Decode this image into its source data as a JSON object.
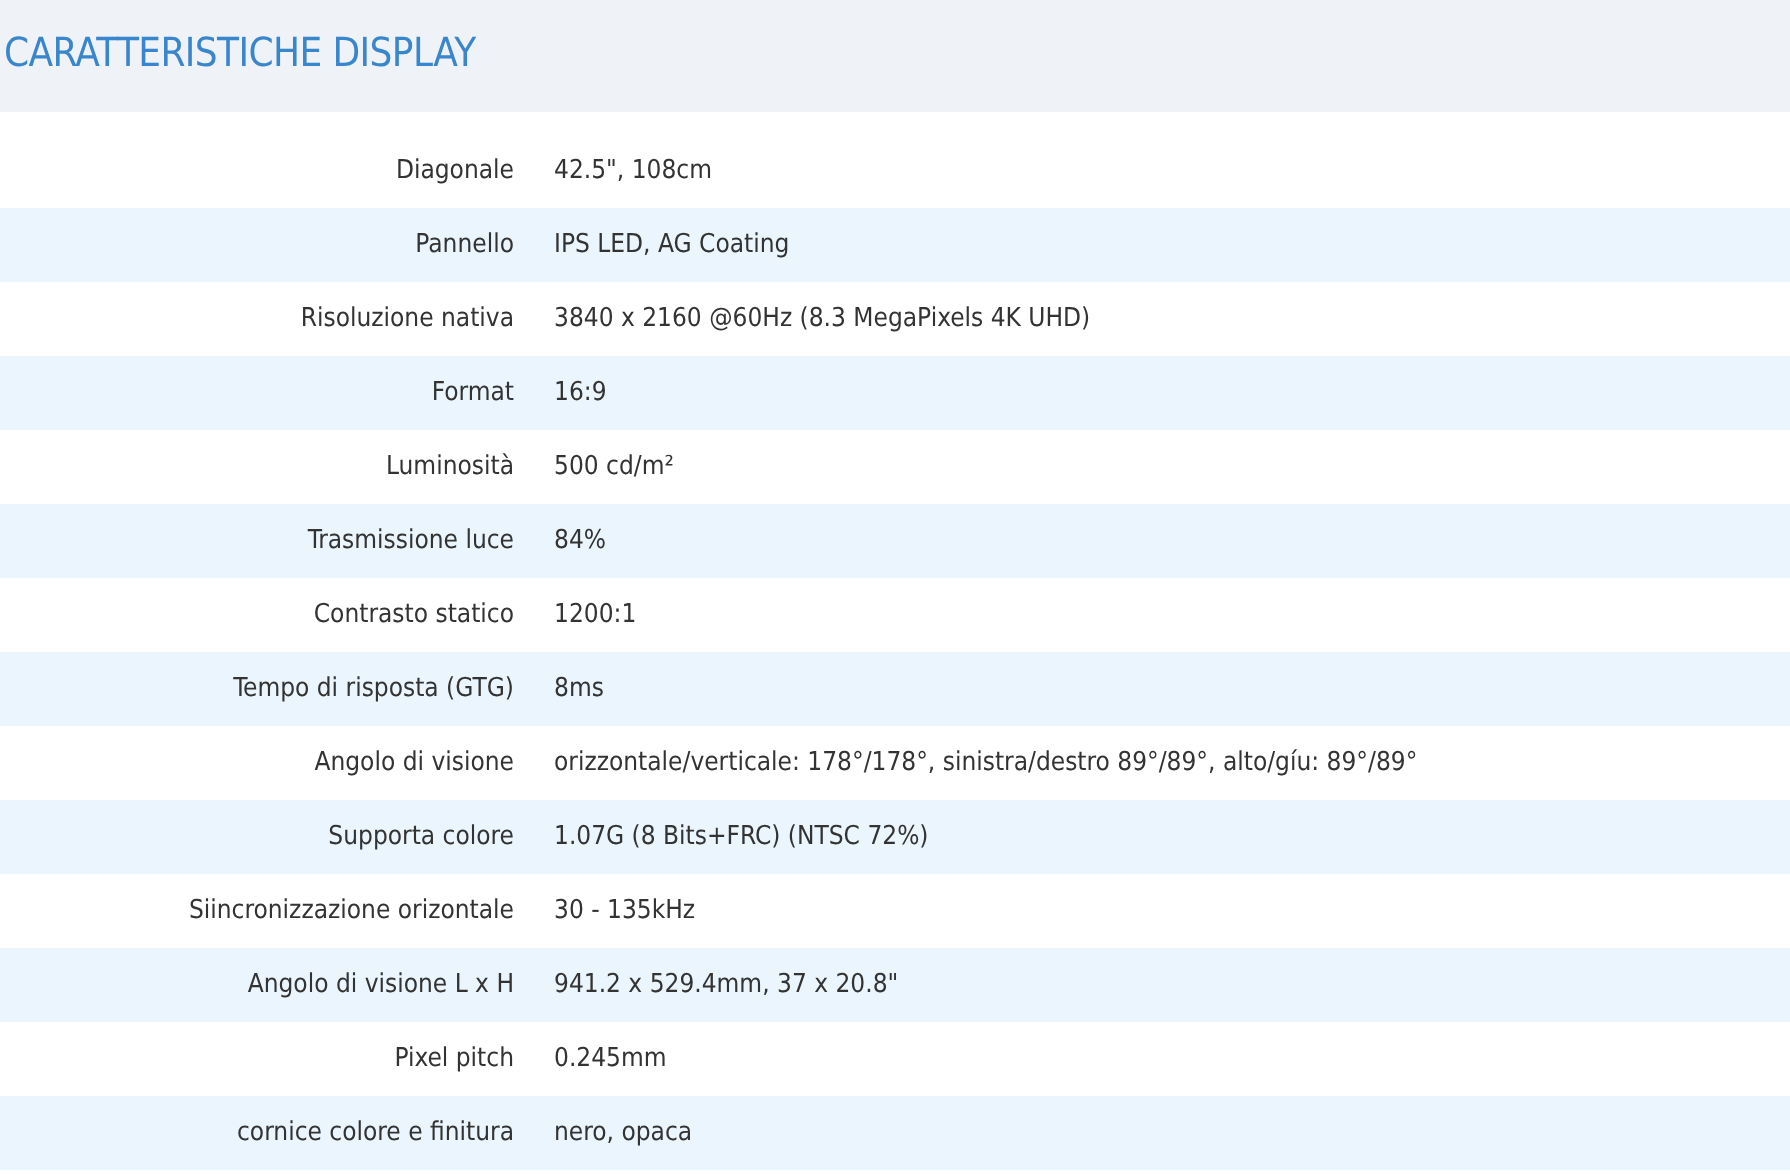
{
  "section": {
    "title": "CARATTERISTICHE DISPLAY"
  },
  "specs": [
    {
      "label": "Diagonale",
      "value": "42.5\", 108cm"
    },
    {
      "label": "Pannello",
      "value": "IPS LED, AG Coating"
    },
    {
      "label": "Risoluzione nativa",
      "value": "3840 x 2160 @60Hz (8.3 MegaPixels 4K UHD)"
    },
    {
      "label": "Format",
      "value": "16:9"
    },
    {
      "label": "Luminosità",
      "value": "500 cd/m²"
    },
    {
      "label": "Trasmissione luce",
      "value": "84%"
    },
    {
      "label": "Contrasto statico",
      "value": "1200:1"
    },
    {
      "label": "Tempo di risposta (GTG)",
      "value": "8ms"
    },
    {
      "label": "Angolo di visione",
      "value": "orizzontale/verticale: 178°/178°, sinistra/destro 89°/89°, alto/gíu: 89°/89°"
    },
    {
      "label": "Supporta colore",
      "value": "1.07G (8 Bits+FRC) (NTSC 72%)"
    },
    {
      "label": "Siincronizzazione orizontale",
      "value": "30 - 135kHz"
    },
    {
      "label": "Angolo di visione L x H",
      "value": "941.2 x 529.4mm, 37 x 20.8\""
    },
    {
      "label": "Pixel pitch",
      "value": "0.245mm"
    },
    {
      "label": "cornice colore e finitura",
      "value": "nero, opaca"
    }
  ]
}
